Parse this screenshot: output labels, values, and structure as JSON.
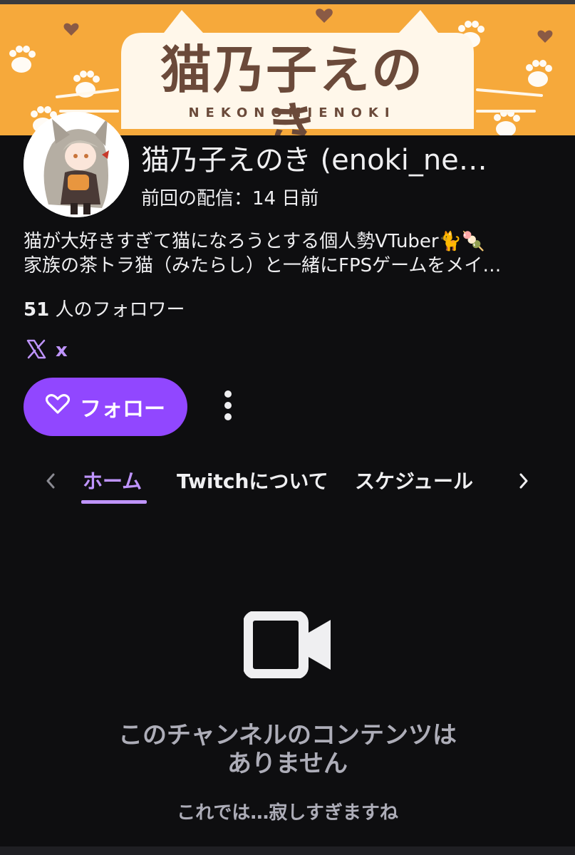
{
  "banner": {
    "title": "猫乃子えのき",
    "subtitle": "NEKONOMIENOKI"
  },
  "channel": {
    "name": "猫乃子えのき (enoki_ne…",
    "last_stream": "前回の配信：14 日前",
    "bio_line1": "猫が大好きすぎて猫になろうとする個人勢VTuber🐈🍡",
    "bio_line2": "家族の茶トラ猫（みたらし）と一緒にFPSゲームをメイ…",
    "followers_count": "51",
    "followers_suffix": " 人のフォロワー"
  },
  "social": {
    "icon": "x-logo-icon",
    "label": "x"
  },
  "actions": {
    "follow_label": "フォロー",
    "follow_icon": "heart-outline-icon",
    "more_icon": "vertical-ellipsis-icon"
  },
  "tabs": {
    "items": [
      {
        "label": "ホーム",
        "active": true
      },
      {
        "label": "Twitchについて",
        "active": false
      },
      {
        "label": "スケジュール",
        "active": false
      }
    ]
  },
  "empty_state": {
    "icon": "video-camera-icon",
    "title_line1": "このチャンネルのコンテンツは",
    "title_line2": "ありません",
    "subtitle": "これでは…寂しすぎますね"
  },
  "colors": {
    "background": "#0e0e10",
    "accent": "#9147ff",
    "accent_light": "#bf94ff",
    "banner": "#f6a93b",
    "muted_text": "#adadb8"
  }
}
